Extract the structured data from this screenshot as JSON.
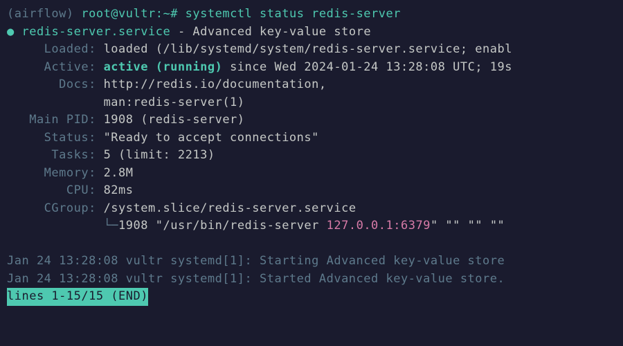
{
  "prompt": {
    "env": "(airflow) ",
    "userhost": "root@vultr",
    "path": ":~# ",
    "command": "systemctl status redis-server"
  },
  "service": {
    "bullet": "●",
    "name": "redis-server.service",
    "separator": " - ",
    "description": "Advanced key-value store"
  },
  "loaded": {
    "label": "     Loaded: ",
    "value": "loaded (/lib/systemd/system/redis-server.service; enabl"
  },
  "active": {
    "label": "     Active: ",
    "status": "active (running)",
    "since": " since Wed 2024-01-24 13:28:08 UTC; 19s"
  },
  "docs": {
    "label": "       Docs: ",
    "url": "http://redis.io/documentation,",
    "indent": "             ",
    "man": "man:redis-server(1)"
  },
  "mainpid": {
    "label": "   Main PID: ",
    "value": "1908 (redis-server)"
  },
  "status": {
    "label": "     Status: ",
    "value": "\"Ready to accept connections\""
  },
  "tasks": {
    "label": "      Tasks: ",
    "value": "5 (limit: 2213)"
  },
  "memory": {
    "label": "     Memory: ",
    "value": "2.8M"
  },
  "cpu": {
    "label": "        CPU: ",
    "value": "82ms"
  },
  "cgroup": {
    "label": "     CGroup: ",
    "value": "/system.slice/redis-server.service",
    "indent": "             ",
    "tree": "└─",
    "pid": "1908 ",
    "binary": "\"/usr/bin/redis-server ",
    "address": "127.0.0.1:6379",
    "trailing": "\" \"\" \"\" \"\""
  },
  "logs": {
    "line1": "Jan 24 13:28:08 vultr systemd[1]: Starting Advanced key-value store",
    "line2": "Jan 24 13:28:08 vultr systemd[1]: Started Advanced key-value store."
  },
  "pager": "lines 1-15/15 (END)"
}
